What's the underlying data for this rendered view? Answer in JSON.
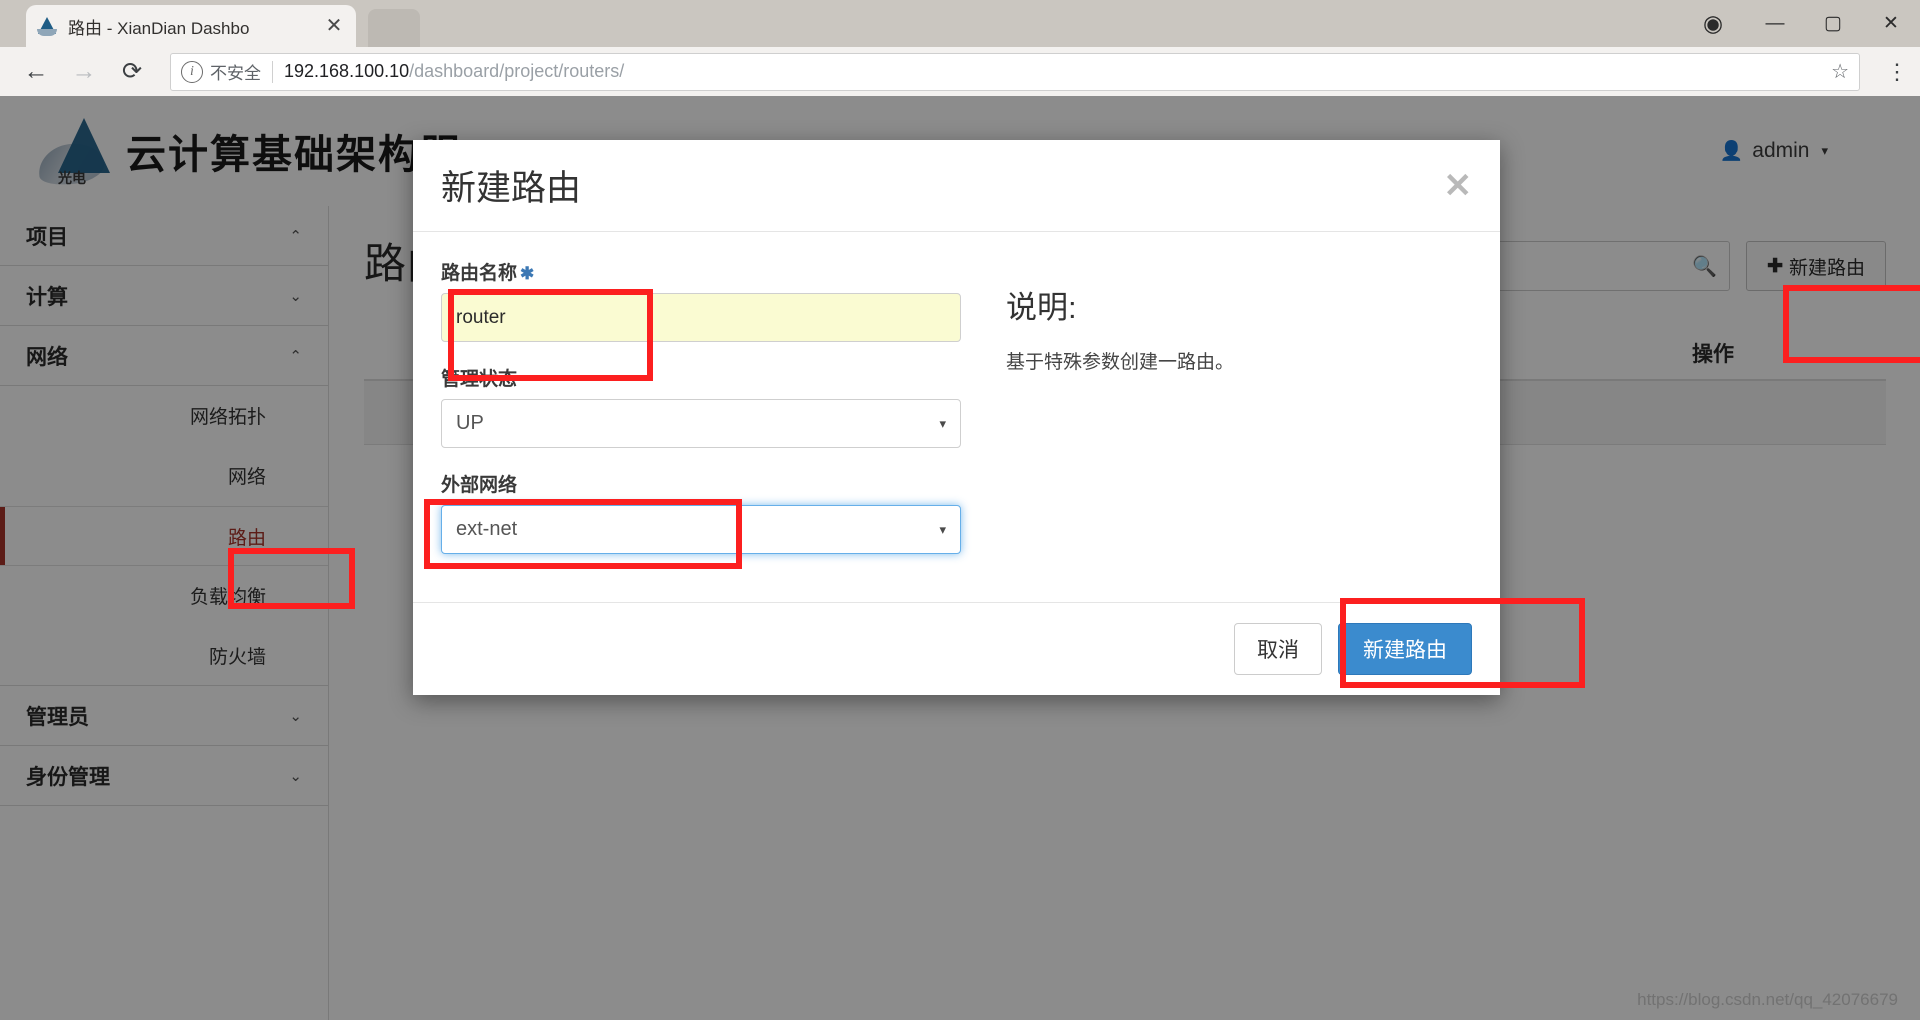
{
  "browser": {
    "tab_title": "路由 - XianDian Dashbo",
    "tab_close": "✕",
    "nav": {
      "back": "←",
      "forward": "→",
      "reload": "⟳"
    },
    "security_label": "不安全",
    "url_host": "192.168.100.10",
    "url_path": "/dashboard/project/routers/",
    "star": "☆",
    "menu": "⋮",
    "window_controls": {
      "profile": "◉",
      "minimize": "—",
      "maximize": "▢",
      "close": "✕"
    }
  },
  "header": {
    "logo_sub": "光电",
    "brand": "云计算基础架构服",
    "user": "admin",
    "user_caret": "▾"
  },
  "sidebar": {
    "groups": [
      {
        "label": "项目",
        "caret": "⌃"
      },
      {
        "label": "计算",
        "caret": "⌄"
      },
      {
        "label": "网络",
        "caret": "⌃"
      }
    ],
    "network_items": [
      {
        "label": "网络拓扑",
        "active": false
      },
      {
        "label": "网络",
        "active": false
      },
      {
        "label": "路由",
        "active": true
      },
      {
        "label": "负载均衡",
        "active": false
      },
      {
        "label": "防火墙",
        "active": false
      }
    ],
    "bottom_groups": [
      {
        "label": "管理员",
        "caret": "⌄"
      },
      {
        "label": "身份管理",
        "caret": "⌄"
      }
    ]
  },
  "main": {
    "page_title": "路由",
    "search_placeholder": "",
    "search_value": "",
    "search_icon": "search-icon",
    "new_router_button": "新建路由",
    "new_router_plus": "✚",
    "column_operations": "操作"
  },
  "modal": {
    "title": "新建路由",
    "close": "✕",
    "fields": {
      "name_label": "路由名称",
      "name_required_mark": "✱",
      "name_value": "router",
      "admin_state_label": "管理状态",
      "admin_state_value": "UP",
      "external_net_label": "外部网络",
      "external_net_value": "ext-net",
      "caret": "▾"
    },
    "description_title": "说明:",
    "description_text": "基于特殊参数创建一路由。",
    "cancel_button": "取消",
    "submit_button": "新建路由"
  },
  "watermark": "https://blog.csdn.net/qq_42076679",
  "colors": {
    "primary_blue": "#3b8bce",
    "annotation_red": "#fc1f1f",
    "autofill_yellow": "#fafbd2",
    "active_red": "#a8342a",
    "focus_blue": "#66afe9"
  }
}
